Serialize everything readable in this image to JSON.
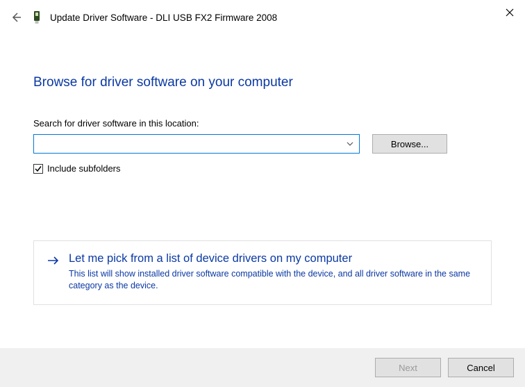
{
  "titlebar": {
    "title": "Update Driver Software - DLI USB FX2 Firmware 2008"
  },
  "main": {
    "heading": "Browse for driver software on your computer",
    "searchLabel": "Search for driver software in this location:",
    "pathValue": "",
    "browseLabel": "Browse...",
    "includeSubfoldersLabel": "Include subfolders",
    "includeSubfoldersChecked": true
  },
  "option": {
    "title": "Let me pick from a list of device drivers on my computer",
    "description": "This list will show installed driver software compatible with the device, and all driver software in the same category as the device."
  },
  "footer": {
    "nextLabel": "Next",
    "cancelLabel": "Cancel"
  }
}
